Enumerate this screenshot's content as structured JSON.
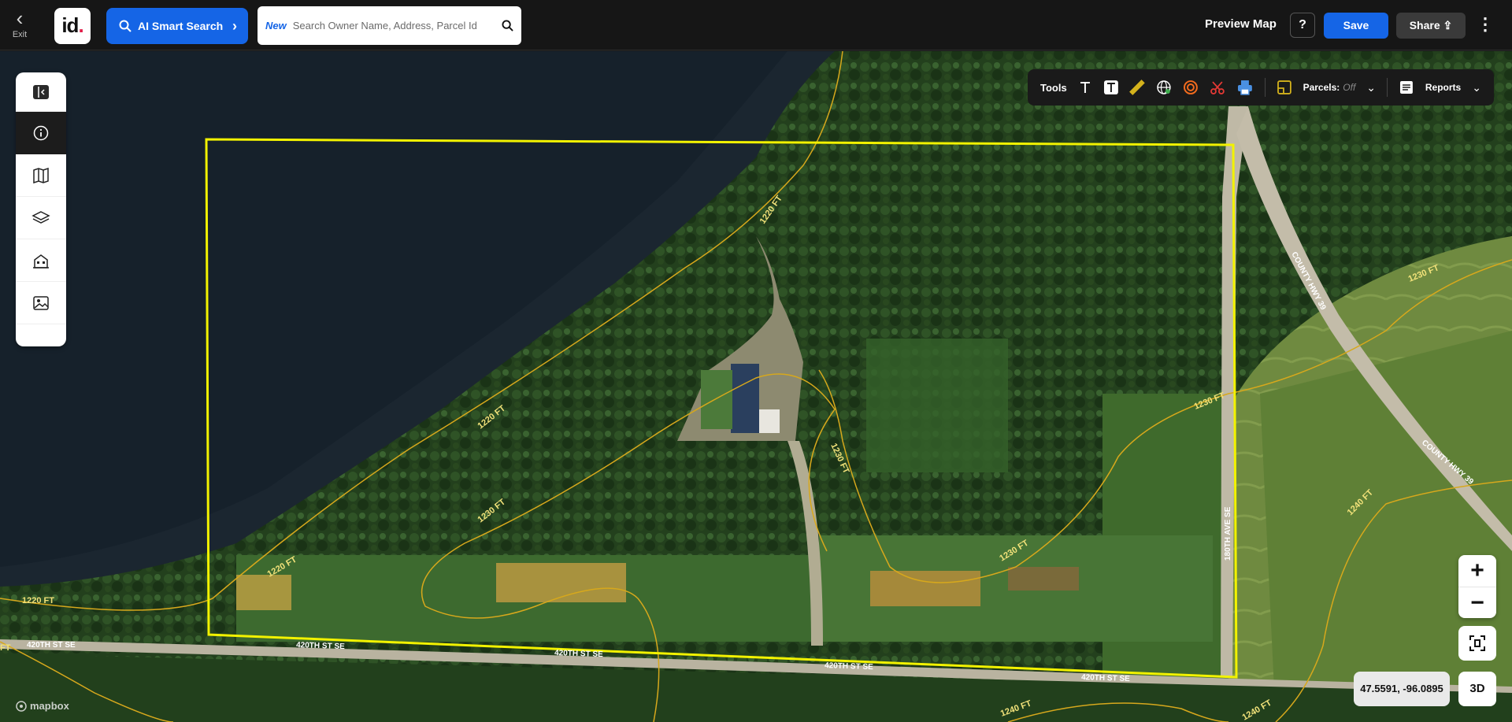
{
  "topbar": {
    "exit_label": "Exit",
    "logo_text": "id",
    "ai_search_label": "AI Smart Search",
    "search_new_badge": "New",
    "search_placeholder": "Search Owner Name, Address, Parcel Id",
    "preview_map_label": "Preview Map",
    "help_label": "?",
    "save_label": "Save",
    "share_label": "Share"
  },
  "sidebar": {
    "items": [
      "panel-toggle-icon",
      "info-icon",
      "map-icon",
      "layers-icon",
      "buildings-icon",
      "image-icon"
    ]
  },
  "tools": {
    "label": "Tools",
    "icons": [
      "text-icon",
      "text-box-icon",
      "ruler-icon",
      "globe-icon",
      "radius-icon",
      "scissors-icon",
      "print-icon"
    ],
    "parcels_label": "Parcels:",
    "parcels_state": "Off",
    "reports_label": "Reports"
  },
  "map": {
    "contour_labels": [
      "1220 FT",
      "1220 FT",
      "1220 FT",
      "1220 FT",
      "1230 FT",
      "1230 FT",
      "1230 FT",
      "1230 FT",
      "1230 FT",
      "1240 FT",
      "1240 FT",
      "1240 FT",
      "FT"
    ],
    "road_labels": [
      "420TH ST SE",
      "420TH ST SE",
      "420TH ST SE",
      "420TH ST SE",
      "420TH ST SE",
      "180TH AVE SE",
      "COUNTY HWY 39",
      "COUNTY HWY 39"
    ],
    "parcel_color": "#f2f200",
    "contour_color": "#d7a81c"
  },
  "controls": {
    "zoom_in": "+",
    "zoom_out": "−",
    "coordinates": "47.5591, -96.0895",
    "view_3d": "3D",
    "attribution": "mapbox"
  }
}
